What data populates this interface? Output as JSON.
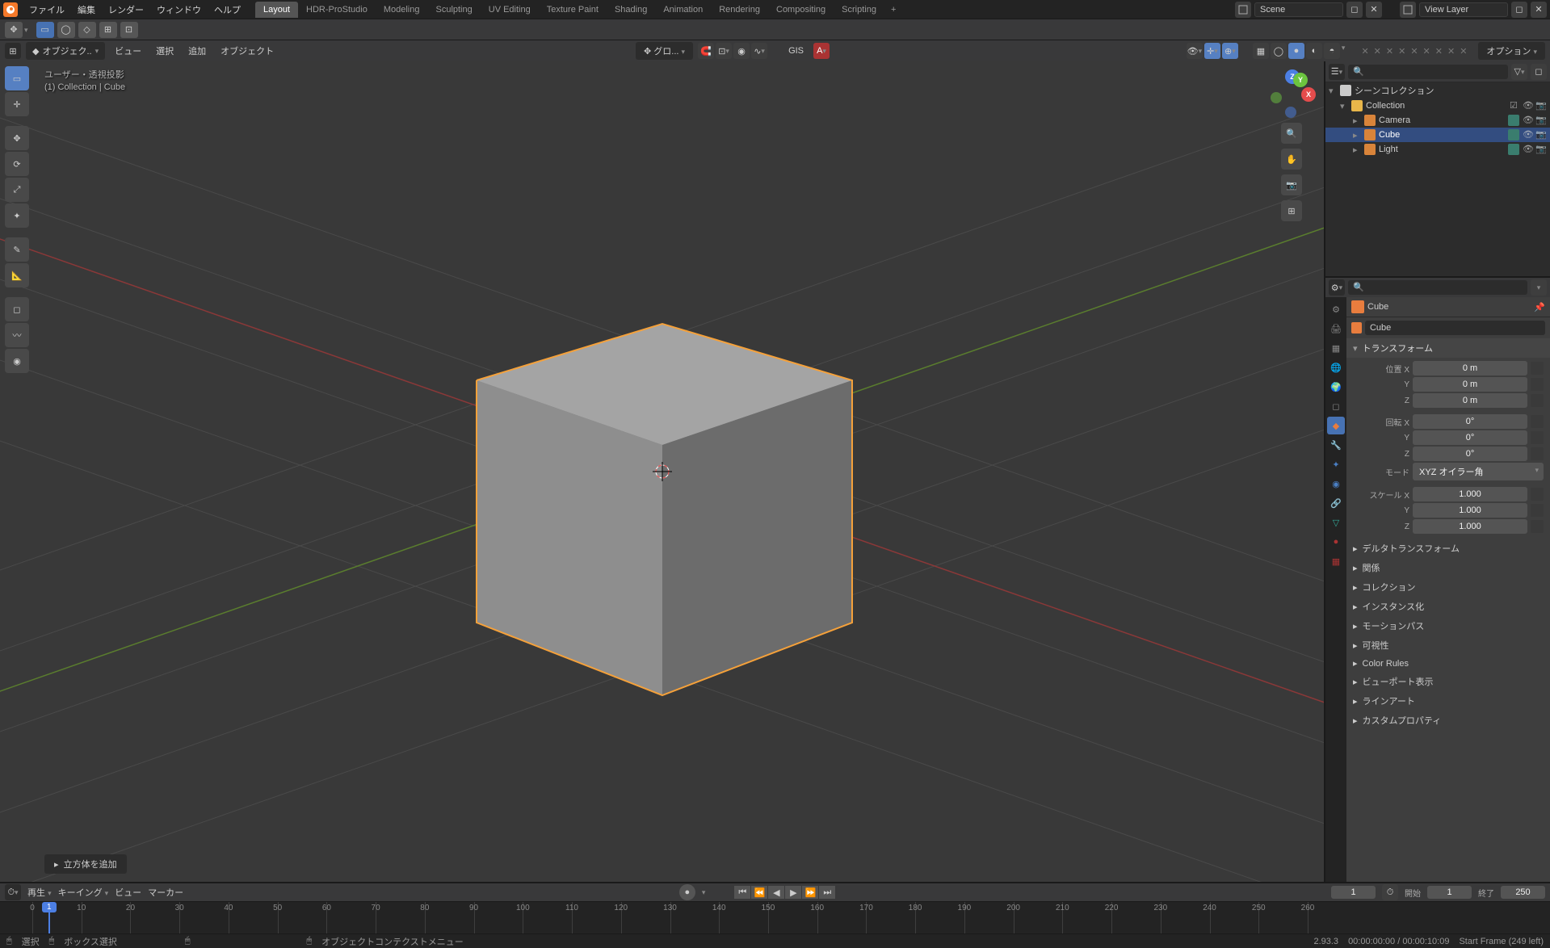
{
  "top_menu": {
    "file": "ファイル",
    "edit": "編集",
    "render": "レンダー",
    "window": "ウィンドウ",
    "help": "ヘルプ"
  },
  "workspaces": [
    "Layout",
    "HDR-ProStudio",
    "Modeling",
    "Sculpting",
    "UV Editing",
    "Texture Paint",
    "Shading",
    "Animation",
    "Rendering",
    "Compositing",
    "Scripting"
  ],
  "scene_label": "Scene",
  "viewlayer_label": "View Layer",
  "mode": "オブジェク..",
  "header2_menus": {
    "view": "ビュー",
    "select": "選択",
    "add": "追加",
    "object": "オブジェクト"
  },
  "options_btn": "オプション",
  "global_label": "グロ...",
  "gis_label": "GIS",
  "viewport_label": {
    "line1": "ユーザー・透視投影",
    "line2": "(1) Collection | Cube"
  },
  "hint": "立方体を追加",
  "tri_collapsed": "▸",
  "tri_expanded": "▾",
  "outliner": {
    "root": "シーンコレクション",
    "coll": "Collection",
    "items": [
      "Camera",
      "Cube",
      "Light"
    ]
  },
  "props": {
    "obj": "Cube",
    "name": "Cube",
    "transform_h": "トランスフォーム",
    "pos": "位置 X",
    "rot": "回転 X",
    "mode_lbl": "モード",
    "mode_val": "XYZ オイラー角",
    "scale": "スケール X",
    "pos_vals": [
      "0 m",
      "0 m",
      "0 m"
    ],
    "rot_vals": [
      "0°",
      "0°",
      "0°"
    ],
    "scale_vals": [
      "1.000",
      "1.000",
      "1.000"
    ],
    "axes": [
      "X",
      "Y",
      "Z"
    ],
    "panels": [
      "デルタトランスフォーム",
      "関係",
      "コレクション",
      "インスタンス化",
      "モーションパス",
      "可視性",
      "Color Rules",
      "ビューポート表示",
      "ラインアート",
      "カスタムプロパティ"
    ]
  },
  "timeline": {
    "play": "再生",
    "keying": "キーイング",
    "view": "ビュー",
    "marker": "マーカー",
    "current": "1",
    "start_lbl": "開始",
    "start": "1",
    "end_lbl": "終了",
    "end": "250",
    "ticks": [
      0,
      10,
      20,
      30,
      40,
      50,
      60,
      70,
      80,
      90,
      100,
      110,
      120,
      130,
      140,
      150,
      160,
      170,
      180,
      190,
      200,
      210,
      220,
      230,
      240,
      250,
      260
    ]
  },
  "status": {
    "sel": "選択",
    "box": "ボックス選択",
    "ctx": "オブジェクトコンテクストメニュー",
    "ver": "2.93.3",
    "time": "00:00:00:00 / 00:00:10:09",
    "frame": "Start Frame (249 left)"
  }
}
